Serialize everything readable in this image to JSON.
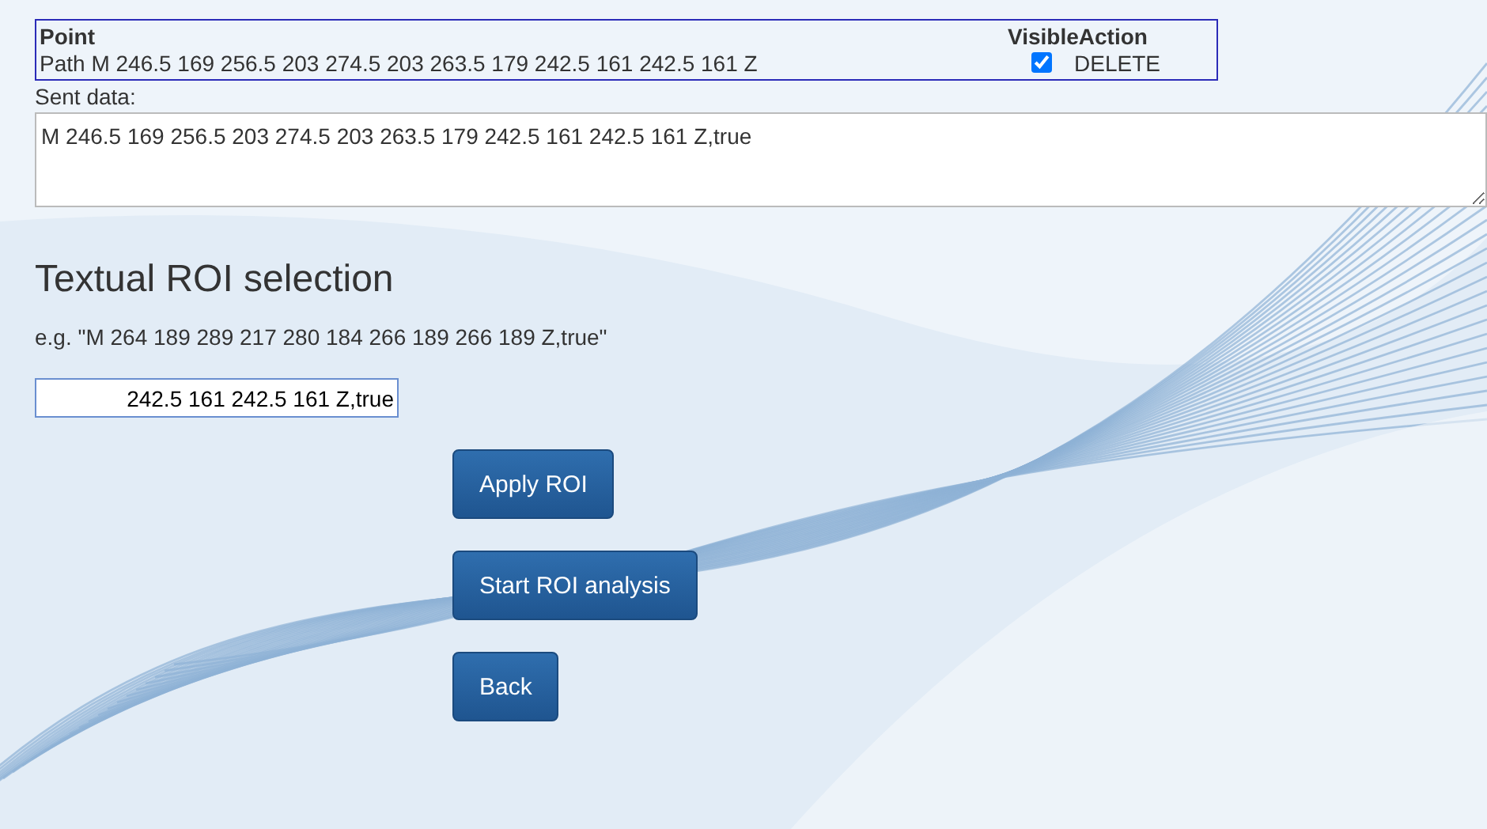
{
  "points_table": {
    "columns": [
      "Point",
      "Visible",
      "Action"
    ],
    "rows": [
      {
        "point": "Path M 246.5 169 256.5 203 274.5 203 263.5 179 242.5 161 242.5 161 Z",
        "visible": true,
        "action": "DELETE"
      }
    ]
  },
  "sent_data": {
    "label": "Sent data:",
    "value": "M 246.5 169 256.5 203 274.5 203 263.5 179 242.5 161 242.5 161 Z,true"
  },
  "roi": {
    "title": "Textual ROI selection",
    "example": "e.g. \"M 264 189 289 217 280 184 266 189 266 189 Z,true\"",
    "value": "242.5 161 242.5 161 Z,true"
  },
  "buttons": [
    "Apply ROI",
    "Start ROI analysis",
    "Back"
  ]
}
